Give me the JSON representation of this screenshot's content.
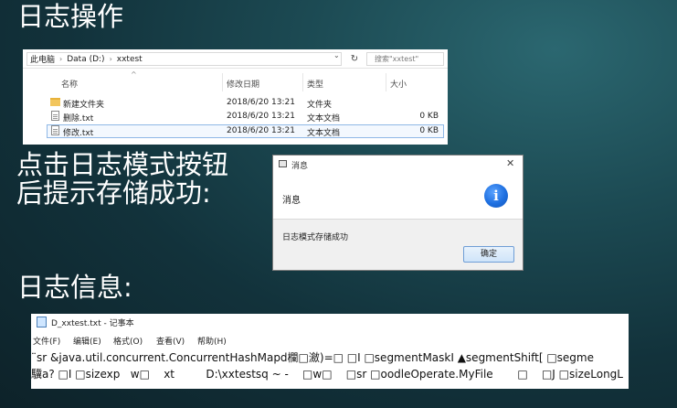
{
  "headings": {
    "section1": "日志操作",
    "section2_line1": "点击日志模式按钮",
    "section2_line2": "后提示存储成功:",
    "section3": "日志信息:"
  },
  "explorer": {
    "breadcrumb": [
      "此电脑",
      "Data (D:)",
      "xxtest"
    ],
    "search_placeholder": "搜索\"xxtest\"",
    "columns": [
      "名称",
      "修改日期",
      "类型",
      "大小"
    ],
    "files": [
      {
        "icon": "folder-icon",
        "name": "新建文件夹",
        "date": "2018/6/20 13:21",
        "type": "文件夹",
        "size": ""
      },
      {
        "icon": "text-file-icon",
        "name": "删除.txt",
        "date": "2018/6/20 13:21",
        "type": "文本文档",
        "size": "0 KB"
      },
      {
        "icon": "text-file-icon",
        "name": "修改.txt",
        "date": "2018/6/20 13:21",
        "type": "文本文档",
        "size": "0 KB"
      }
    ]
  },
  "dialog": {
    "title": "消息",
    "header": "消息",
    "icon": "info-icon",
    "message": "日志模式存储成功",
    "ok_label": "确定"
  },
  "notepad": {
    "title": "D_xxtest.txt - 记事本",
    "menu": [
      "文件(F)",
      "编辑(E)",
      "格式(O)",
      "查看(V)",
      "帮助(H)"
    ],
    "lines": [
      "¨sr &java.util.concurrent.ConcurrentHashMapd欄□瀲)=□ □I □segmentMaskI ▲segmentShift[ □segme",
      "驥a? □I □sizexp   w□    xt         D:\\xxtestsq ~ -    □w□    □sr □oodleOperate.MyFile       □    □J □sizeLongL"
    ]
  }
}
